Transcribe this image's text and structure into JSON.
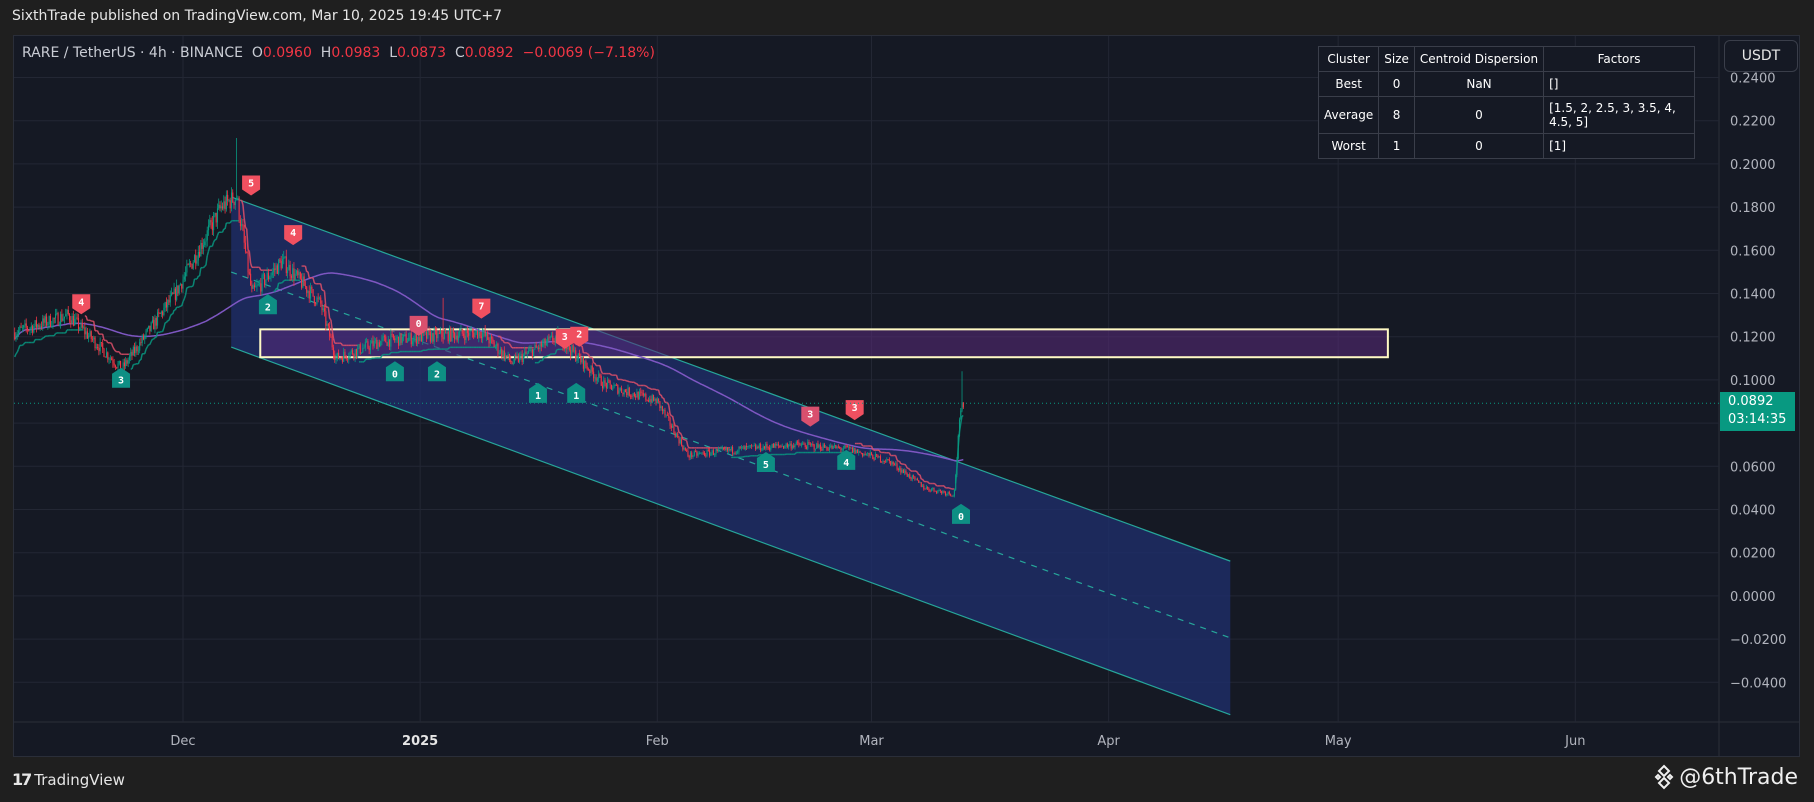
{
  "header": {
    "published": "SixthTrade published on TradingView.com, Mar 10, 2025 19:45 UTC+7"
  },
  "symbol": {
    "title": "RARE / TetherUS · 4h · BINANCE",
    "o_label": "O",
    "o": "0.0960",
    "h_label": "H",
    "h": "0.0983",
    "l_label": "L",
    "l": "0.0873",
    "c_label": "C",
    "c": "0.0892",
    "change": "−0.0069 (−7.18%)"
  },
  "currency_button": "USDT",
  "last_price": {
    "price": "0.0892",
    "countdown": "03:14:35"
  },
  "table": {
    "headers": [
      "Cluster",
      "Size",
      "Centroid Dispersion",
      "Factors"
    ],
    "rows": [
      [
        "Best",
        "0",
        "NaN",
        "[]"
      ],
      [
        "Average",
        "8",
        "0",
        "[1.5, 2, 2.5, 3, 3.5, 4, 4.5, 5]"
      ],
      [
        "Worst",
        "1",
        "0",
        "[1]"
      ]
    ]
  },
  "footer": {
    "brand": "TradingView",
    "author": "@6thTrade"
  },
  "colors": {
    "up": "#089981",
    "down": "#f23645",
    "ma": "#7e57c2",
    "channel": "#26a69a",
    "zone_border": "#fff9c4"
  },
  "chart_data": {
    "type": "candlestick",
    "title": "RARE / TetherUS 4h",
    "x_unit": "days since 2024-12-01",
    "ylim": [
      -0.05,
      0.25
    ],
    "y_ticks": [
      "0.2400",
      "0.2200",
      "0.2000",
      "0.1800",
      "0.1600",
      "0.1400",
      "0.1200",
      "0.1000",
      "0.0800",
      "0.0600",
      "0.0400",
      "0.0200",
      "0.0000",
      "−0.0200",
      "−0.0400"
    ],
    "y_tick_values": [
      0.24,
      0.22,
      0.2,
      0.18,
      0.16,
      0.14,
      0.12,
      0.1,
      0.08,
      0.06,
      0.04,
      0.02,
      0,
      -0.02,
      -0.04
    ],
    "x_ticks": [
      {
        "label": "Dec",
        "day": 0
      },
      {
        "label": "2025",
        "day": 31,
        "bold": true
      },
      {
        "label": "Feb",
        "day": 62
      },
      {
        "label": "Mar",
        "day": 90
      },
      {
        "label": "Apr",
        "day": 121
      },
      {
        "label": "May",
        "day": 151
      },
      {
        "label": "Jun",
        "day": 182
      }
    ],
    "price_path": [
      [
        -22,
        0.122
      ],
      [
        -15,
        0.13
      ],
      [
        -8,
        0.105
      ],
      [
        -1,
        0.14
      ],
      [
        5,
        0.18
      ],
      [
        7,
        0.185
      ],
      [
        9,
        0.14
      ],
      [
        13,
        0.155
      ],
      [
        18,
        0.135
      ],
      [
        20,
        0.11
      ],
      [
        26,
        0.118
      ],
      [
        32,
        0.12
      ],
      [
        39,
        0.122
      ],
      [
        43,
        0.108
      ],
      [
        49,
        0.12
      ],
      [
        55,
        0.098
      ],
      [
        62,
        0.09
      ],
      [
        66,
        0.065
      ],
      [
        73,
        0.068
      ],
      [
        80,
        0.07
      ],
      [
        87,
        0.068
      ],
      [
        92.5,
        0.062
      ],
      [
        97,
        0.05
      ],
      [
        100.8,
        0.047
      ],
      [
        101.6,
        0.085
      ],
      [
        102,
        0.0892
      ]
    ],
    "spike_high": [
      [
        7,
        0.212
      ],
      [
        34,
        0.138
      ],
      [
        101.9,
        0.104
      ]
    ],
    "channel": {
      "upper": [
        [
          6.3,
          0.1847
        ],
        [
          136.9,
          0.0161
        ]
      ],
      "lower": [
        [
          6.3,
          0.1152
        ],
        [
          136.9,
          -0.055
        ]
      ]
    },
    "zone": {
      "day_from": 10.1,
      "day_to": 157.5,
      "price_low": 0.1105,
      "price_high": 0.1234
    },
    "signals": [
      {
        "type": "sell",
        "n": "4",
        "day": -13.3,
        "price": 0.135
      },
      {
        "type": "sell",
        "n": "5",
        "day": 8.9,
        "price": 0.19
      },
      {
        "type": "sell",
        "n": "4",
        "day": 14.4,
        "price": 0.167
      },
      {
        "type": "sell",
        "n": "0",
        "day": 30.8,
        "price": 0.125
      },
      {
        "type": "sell",
        "n": "7",
        "day": 39,
        "price": 0.133
      },
      {
        "type": "sell",
        "n": "3",
        "day": 49.9,
        "price": 0.119
      },
      {
        "type": "sell",
        "n": "2",
        "day": 51.8,
        "price": 0.12
      },
      {
        "type": "sell",
        "n": "3",
        "day": 82,
        "price": 0.083
      },
      {
        "type": "sell",
        "n": "3",
        "day": 87.8,
        "price": 0.086
      },
      {
        "type": "buy",
        "n": "3",
        "day": -8.1,
        "price": 0.101
      },
      {
        "type": "buy",
        "n": "2",
        "day": 11.1,
        "price": 0.135
      },
      {
        "type": "buy",
        "n": "0",
        "day": 27.7,
        "price": 0.104
      },
      {
        "type": "buy",
        "n": "2",
        "day": 33.2,
        "price": 0.104
      },
      {
        "type": "buy",
        "n": "1",
        "day": 46.4,
        "price": 0.094
      },
      {
        "type": "buy",
        "n": "1",
        "day": 51.4,
        "price": 0.094
      },
      {
        "type": "buy",
        "n": "5",
        "day": 76.2,
        "price": 0.062
      },
      {
        "type": "buy",
        "n": "4",
        "day": 86.7,
        "price": 0.063
      },
      {
        "type": "buy",
        "n": "0",
        "day": 101.7,
        "price": 0.038
      }
    ]
  }
}
